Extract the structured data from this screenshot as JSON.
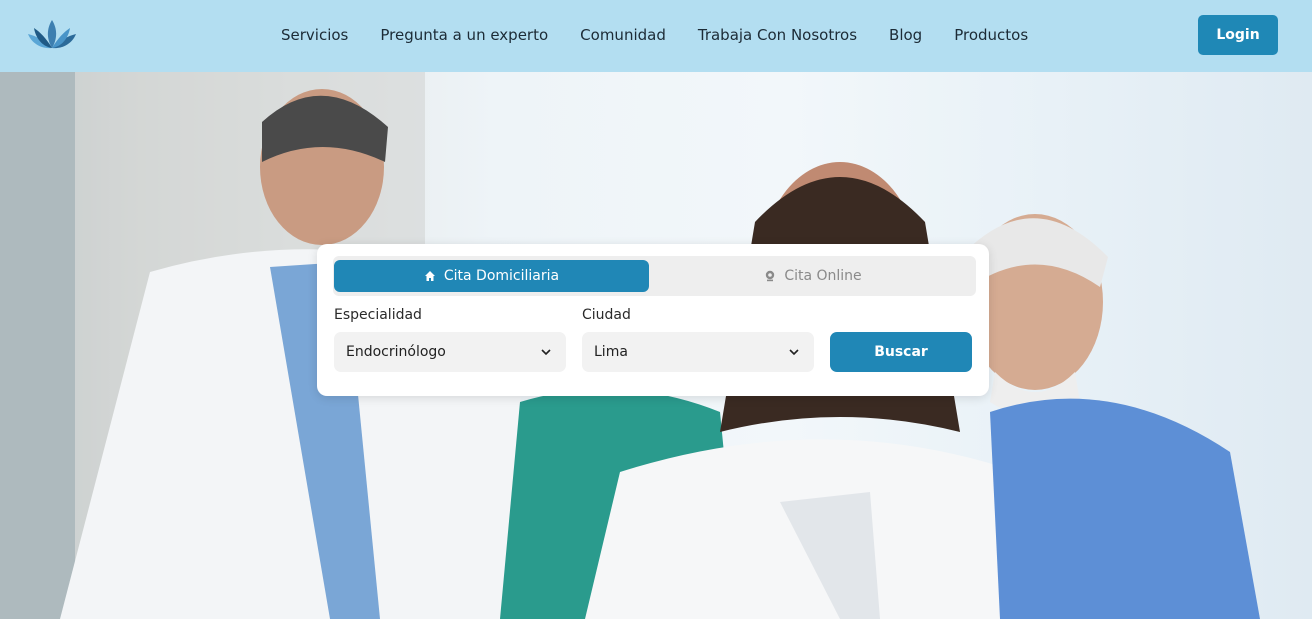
{
  "nav": {
    "logo_icon": "lotus-icon",
    "links": [
      {
        "label": "Servicios"
      },
      {
        "label": "Pregunta a un experto"
      },
      {
        "label": "Comunidad"
      },
      {
        "label": "Trabaja Con Nosotros"
      },
      {
        "label": "Blog"
      },
      {
        "label": "Productos"
      }
    ],
    "login_label": "Login"
  },
  "search": {
    "tabs": [
      {
        "label": "Cita Domiciliaria",
        "icon": "home-icon",
        "active": true
      },
      {
        "label": "Cita Online",
        "icon": "webcam-icon",
        "active": false
      }
    ],
    "specialty_label": "Especialidad",
    "specialty_value": "Endocrinólogo",
    "city_label": "Ciudad",
    "city_value": "Lima",
    "button_label": "Buscar"
  },
  "colors": {
    "nav_bg": "#b3def1",
    "accent": "#2087b6"
  }
}
